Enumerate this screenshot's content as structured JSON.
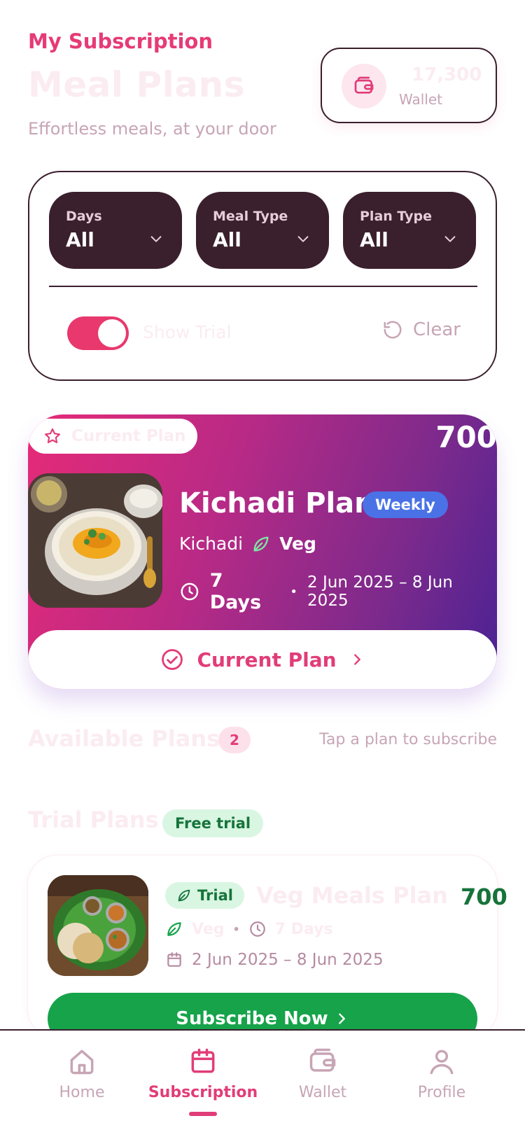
{
  "header": {
    "eyebrow": "My Subscription",
    "title": "Meal Plans",
    "subtitle": "Effortless meals, at your door"
  },
  "wallet": {
    "amount": "17,300",
    "label": "Wallet",
    "icon": "wallet-icon"
  },
  "filters": {
    "days": {
      "label": "Days",
      "value": "All"
    },
    "meal_type": {
      "label": "Meal Type",
      "value": "All"
    },
    "plan_type": {
      "label": "Plan Type",
      "value": "All"
    },
    "show_trial": {
      "label": "Show Trial",
      "enabled": true
    },
    "clear_label": "Clear"
  },
  "current_plan": {
    "badge": "Current Plan",
    "price": "700",
    "name": "Kichadi Plan",
    "frequency": "Weekly",
    "meal": "Kichadi",
    "diet": "Veg",
    "duration": "7 Days",
    "date_range": "2 Jun 2025 – 8 Jun 2025",
    "action_label": "Current Plan"
  },
  "available": {
    "title": "Available Plans",
    "count": "2",
    "hint": "Tap a plan to subscribe"
  },
  "trial_section": {
    "title": "Trial Plans",
    "badge": "Free trial"
  },
  "trial_plan": {
    "tag": "Trial",
    "name": "Veg Meals Plan",
    "price": "700",
    "diet": "Veg",
    "duration": "7 Days",
    "date_range": "2 Jun 2025 – 8 Jun 2025",
    "button": "Subscribe Now"
  },
  "nav": {
    "items": [
      {
        "label": "Home",
        "icon": "home-icon"
      },
      {
        "label": "Subscription",
        "icon": "calendar-icon",
        "active": true
      },
      {
        "label": "Wallet",
        "icon": "wallet-icon"
      },
      {
        "label": "Profile",
        "icon": "user-icon"
      }
    ]
  },
  "colors": {
    "accent": "#e13d78",
    "dark": "#3a1f2d",
    "success": "#16a34a",
    "weekly_badge": "#4a72e6"
  }
}
